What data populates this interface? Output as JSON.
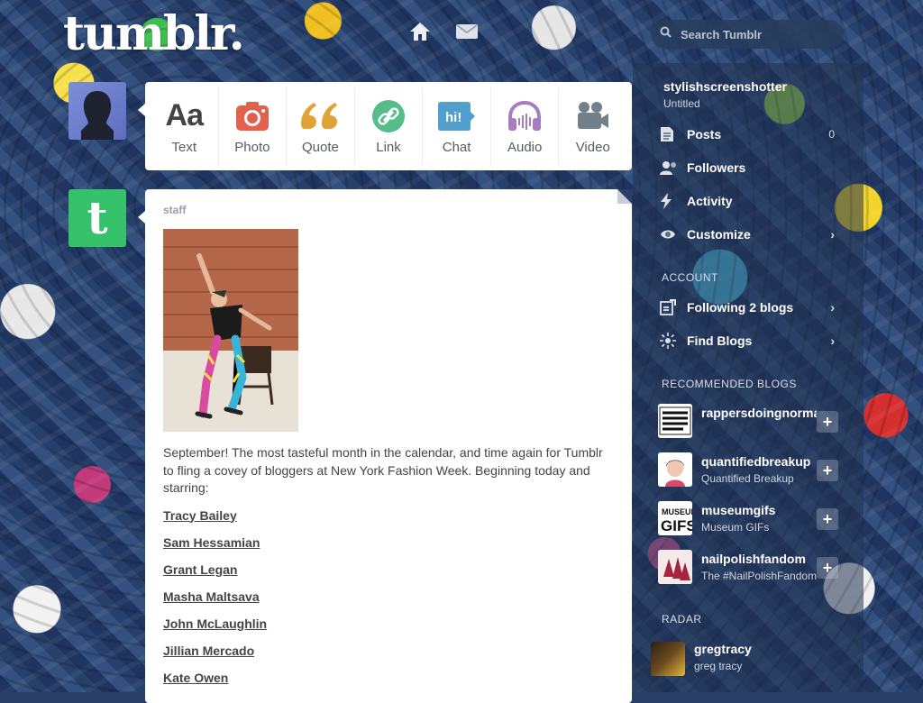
{
  "header": {
    "logo": "tumblr.",
    "home_icon": "home-icon",
    "mail_icon": "mail-icon",
    "search": {
      "placeholder": "Search Tumblr",
      "value": ""
    }
  },
  "composer": {
    "types": [
      {
        "label": "Text",
        "icon": "text-icon",
        "color": "#444444"
      },
      {
        "label": "Photo",
        "icon": "camera-icon",
        "color": "#e0614e"
      },
      {
        "label": "Quote",
        "icon": "quote-icon",
        "color": "#e1a336"
      },
      {
        "label": "Link",
        "icon": "link-icon",
        "color": "#56bc8a"
      },
      {
        "label": "Chat",
        "icon": "chat-icon",
        "color": "#529ecc"
      },
      {
        "label": "Audio",
        "icon": "headphones-icon",
        "color": "#a77dc2"
      },
      {
        "label": "Video",
        "icon": "video-camera-icon",
        "color": "#748089"
      }
    ]
  },
  "post": {
    "author": "staff",
    "body": "September! The most tasteful month in the calendar, and time again for Tumblr to fling a covey of bloggers at New York Fashion Week. Beginning today and starring:",
    "links": [
      "Tracy Bailey",
      "Sam Hessamian",
      "Grant Legan",
      "Masha Maltsava",
      "John McLaughlin",
      "Jillian Mercado",
      "Kate Owen"
    ]
  },
  "sidebar": {
    "blog_name": "stylishscreenshotter",
    "blog_subtitle": "Untitled",
    "menu": [
      {
        "label": "Posts",
        "icon": "posts-icon",
        "count": "0"
      },
      {
        "label": "Followers",
        "icon": "followers-icon",
        "count": ""
      },
      {
        "label": "Activity",
        "icon": "activity-icon",
        "count": ""
      },
      {
        "label": "Customize",
        "icon": "eye-icon",
        "count": ""
      }
    ],
    "account_heading": "ACCOUNT",
    "account_menu": [
      {
        "label": "Following 2 blogs",
        "icon": "following-icon"
      },
      {
        "label": "Find Blogs",
        "icon": "find-blogs-icon"
      }
    ],
    "recommended_heading": "RECOMMENDED BLOGS",
    "recommended": [
      {
        "name": "rappersdoingnormalstuff",
        "subtitle": "",
        "avatar_text": "RAPPERS DOING NORMAL SHIT"
      },
      {
        "name": "quantifiedbreakup",
        "subtitle": "Quantified Breakup",
        "avatar_text": ""
      },
      {
        "name": "museumgifs",
        "subtitle": "Museum GIFs",
        "avatar_text": "MUSEUM GIFS"
      },
      {
        "name": "nailpolishfandom",
        "subtitle": "The #NailPolishFandom",
        "avatar_text": ""
      }
    ],
    "radar_heading": "RADAR",
    "radar": {
      "name": "gregtracy",
      "subtitle": "greg tracy"
    }
  }
}
